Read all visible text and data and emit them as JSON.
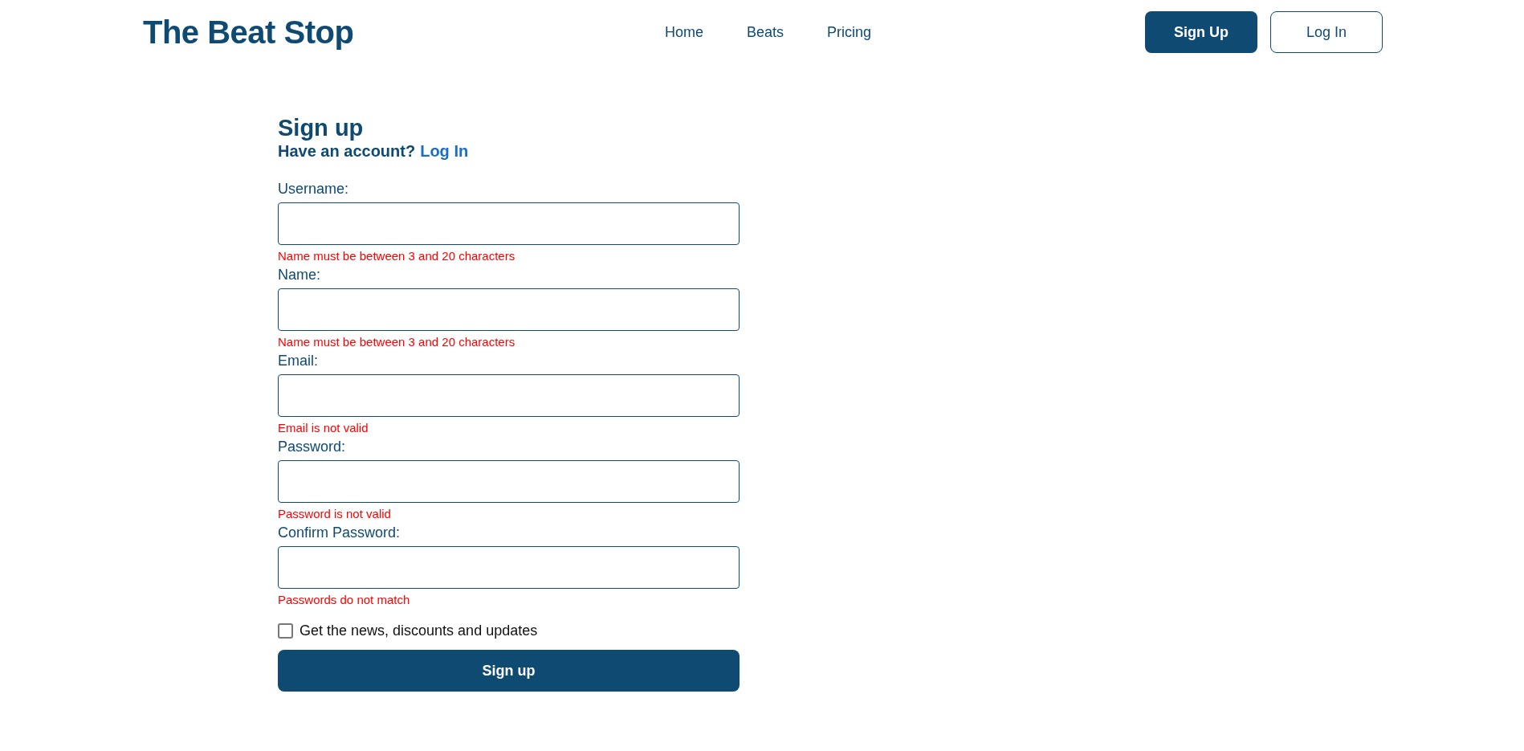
{
  "header": {
    "logo": "The Beat Stop",
    "nav": [
      "Home",
      "Beats",
      "Pricing"
    ],
    "buttons": [
      {
        "label": "Sign Up",
        "kind": "primary"
      },
      {
        "label": "Log In",
        "kind": "outline"
      }
    ]
  },
  "form": {
    "title": "Sign up",
    "subtitle": "Have an account?",
    "subtitle_link": "Log In",
    "fields": [
      {
        "label": "Username:",
        "error": "Name must be between 3 and 20 characters"
      },
      {
        "label": "Name:",
        "error": "Name must be between 3 and 20 characters"
      },
      {
        "label": "Email:",
        "error": "Email is not valid"
      },
      {
        "label": "Password:",
        "error": "Password is not valid"
      },
      {
        "label": "Confirm Password:",
        "error": "Passwords do not match"
      }
    ],
    "checkbox": {
      "label": "Get the news, discounts and updates",
      "checked": false
    },
    "submit": "Sign up"
  }
}
